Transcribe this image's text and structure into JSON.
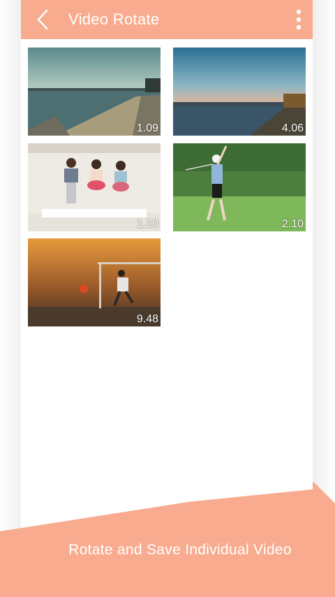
{
  "app": {
    "title": "Video Rotate",
    "accent_color": "#f8ab8e",
    "back_icon": "chevron-left-icon",
    "menu_icon": "more-vertical-icon"
  },
  "videos": [
    {
      "duration": "1.09",
      "scene": "seaside-promenade"
    },
    {
      "duration": "4.06",
      "scene": "city-skyline-bay"
    },
    {
      "duration": "1.10",
      "scene": "kids-jumping-on-bed"
    },
    {
      "duration": "2.10",
      "scene": "girl-playing-golf"
    },
    {
      "duration": "9.48",
      "scene": "boy-kicking-football-sunset"
    }
  ],
  "caption": "Rotate and Save Individual Video"
}
